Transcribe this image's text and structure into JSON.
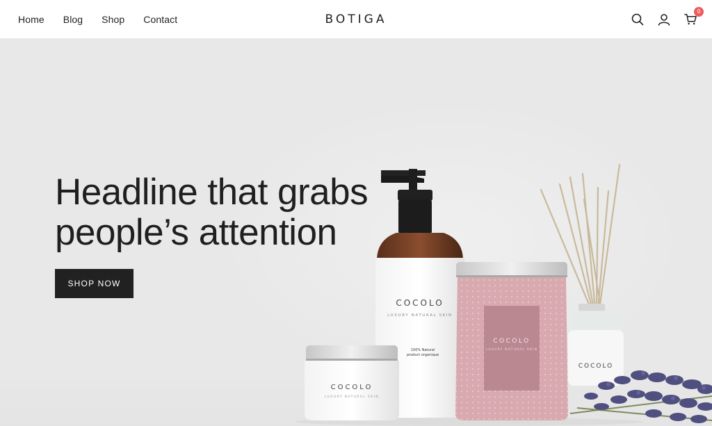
{
  "header": {
    "nav": [
      {
        "label": "Home"
      },
      {
        "label": "Blog"
      },
      {
        "label": "Shop"
      },
      {
        "label": "Contact"
      }
    ],
    "logo": "BOTIGA",
    "icons": [
      "search-icon",
      "user-icon",
      "cart-icon"
    ],
    "cart_count": "0"
  },
  "hero": {
    "headline_line1": "Headline that grabs",
    "headline_line2": "people’s attention",
    "cta_label": "SHOP NOW"
  },
  "products": {
    "brand": "COCOLO",
    "tagline": "LUXURY NATURAL SKIN",
    "bottle_note_1": "100% Natural",
    "bottle_note_2": "product organique"
  },
  "colors": {
    "accent_dark": "#212121",
    "badge": "#ef5a5a",
    "hero_bg": "#e8e8e8",
    "jar_pink": "#d9a9b0"
  }
}
